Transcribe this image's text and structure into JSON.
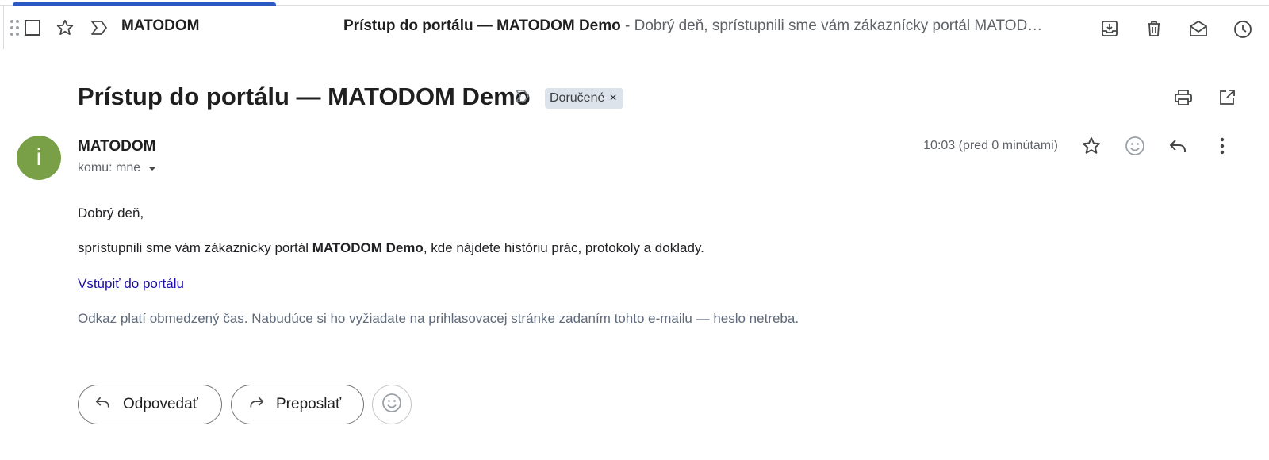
{
  "toolbar": {
    "sender": "MATODOM",
    "snippet_subject": "Prístup do portálu — MATODOM Demo",
    "snippet_separator": " - ",
    "snippet_text": "Dobrý deň, sprístupnili sme vám zákaznícky portál MATOD…",
    "icons": [
      "drag-handle-icon",
      "checkbox-icon",
      "star-icon",
      "important-icon",
      "archive-icon",
      "delete-icon",
      "mark-as-read-icon",
      "snooze-icon"
    ],
    "progress_color": "#2b59c3"
  },
  "subject": {
    "title": "Prístup do portálu — MATODOM Demo",
    "label": "Doručené",
    "label_close": "×",
    "icons": [
      "important-icon",
      "print-icon",
      "open-in-new-window-icon"
    ]
  },
  "message": {
    "avatar_letter": "i",
    "avatar_color": "#79a047",
    "sender": "MATODOM",
    "recipient": "komu: mne",
    "timestamp": "10:03 (pred 0 minútami)",
    "icons": [
      "star-icon",
      "emoji-icon",
      "reply-icon",
      "more-vert-icon"
    ]
  },
  "body": {
    "greeting": "Dobrý deň,",
    "para_before": "sprístupnili sme vám zákaznícky portál ",
    "para_bold": "MATODOM Demo",
    "para_after": ", kde nájdete históriu prác, protokoly a doklady.",
    "link": "Vstúpiť do portálu",
    "note": "Odkaz platí obmedzený čas. Nabudúce si ho vyžiadate na prihlasovacej stránke zadaním tohto e-mailu — heslo netreba."
  },
  "actions": {
    "reply": "Odpovedať",
    "forward": "Preposlať"
  }
}
